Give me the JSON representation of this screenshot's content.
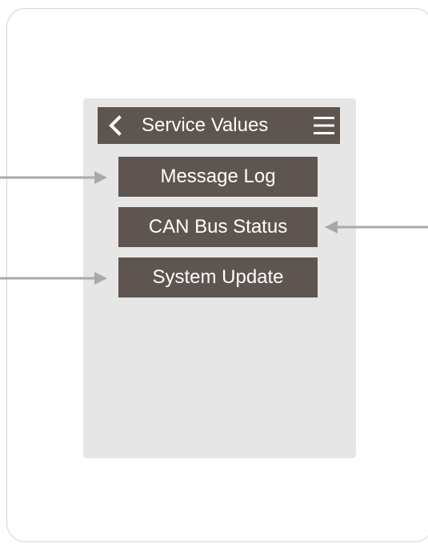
{
  "header": {
    "title": "Service Values",
    "back_icon": "chevron-left-icon",
    "menu_icon": "hamburger-menu-icon"
  },
  "menu": {
    "items": [
      {
        "label": "Message Log"
      },
      {
        "label": "CAN Bus Status"
      },
      {
        "label": "System Update"
      }
    ]
  },
  "colors": {
    "button_bg": "#5e5550",
    "panel_bg": "#e6e6e7",
    "arrow": "#a9a9a9",
    "text": "#ffffff"
  }
}
